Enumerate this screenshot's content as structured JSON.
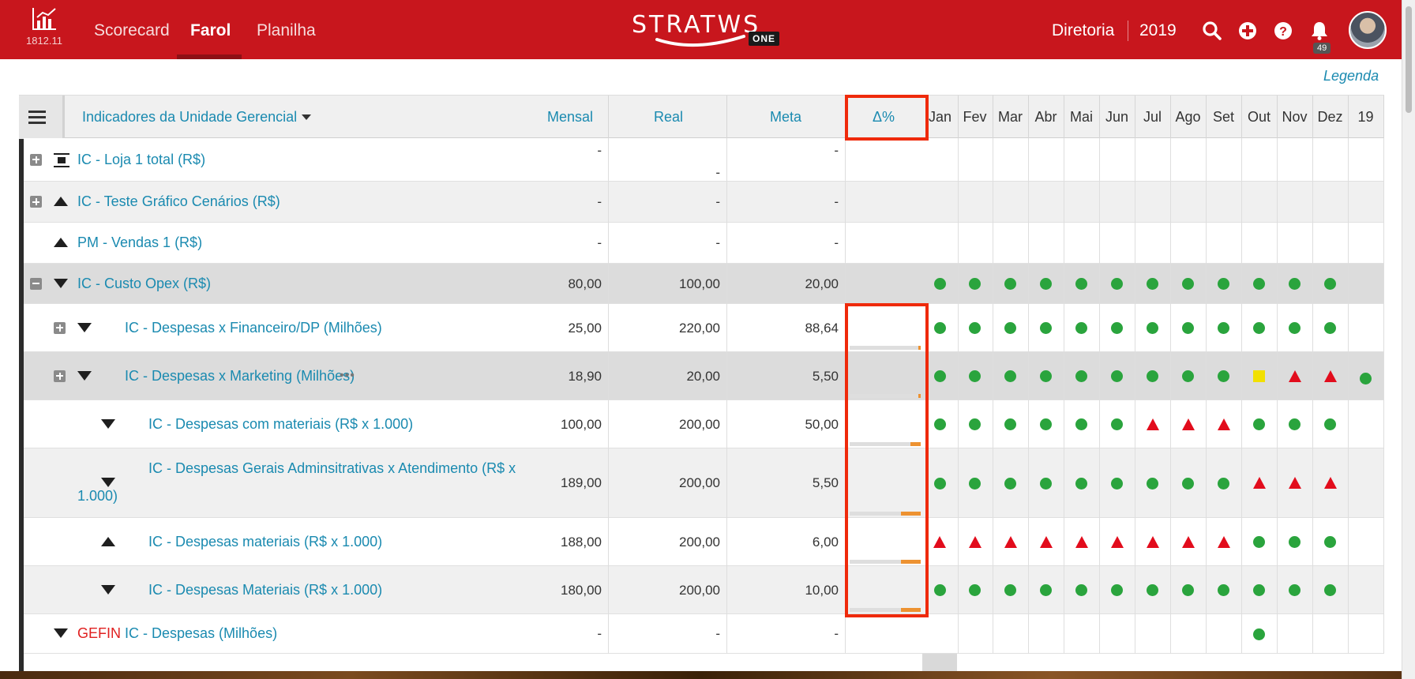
{
  "header": {
    "version": "1812.11",
    "tabs": [
      {
        "label": "Scorecard",
        "active": false
      },
      {
        "label": "Farol",
        "active": true
      },
      {
        "label": "Planilha",
        "active": false
      }
    ],
    "logo_text": "STRATWS",
    "logo_badge": "ONE",
    "unit": "Diretoria",
    "year": "2019",
    "notifications": "49",
    "icons": [
      "search-icon",
      "plus-circle-icon",
      "help-icon",
      "bell-icon"
    ]
  },
  "legend_link": "Legenda",
  "table": {
    "header": {
      "title": "Indicadores da Unidade Gerencial",
      "period": "Mensal",
      "real": "Real",
      "meta": "Meta",
      "delta": "Δ%",
      "months": [
        "Jan",
        "Fev",
        "Mar",
        "Abr",
        "Mai",
        "Jun",
        "Jul",
        "Ago",
        "Set",
        "Out",
        "Nov",
        "Dez",
        "19"
      ]
    },
    "rows": [
      {
        "name": "IC - Loja 1 total (R$)",
        "real": "-",
        "meta": "-",
        "delta": "-",
        "icon": "rectangle-lines-icon",
        "expand": "plus"
      },
      {
        "name": "IC - Teste Gráfico Cenários (R$)",
        "real": "-",
        "meta": "-",
        "delta": "-",
        "icon": "triangle-up-icon",
        "expand": "plus"
      },
      {
        "name": "PM - Vendas 1 (R$)",
        "real": "-",
        "meta": "-",
        "delta": "-",
        "icon": "triangle-up-icon",
        "expand": ""
      },
      {
        "name": "IC - Custo Opex (R$)",
        "real": "80,00",
        "meta": "100,00",
        "delta": "20,00",
        "icon": "triangle-down-icon",
        "expand": "minus"
      },
      {
        "name": "IC - Despesas x Financeiro/DP (Milhões)",
        "real": "25,00",
        "meta": "220,00",
        "delta": "88,64",
        "icon": "triangle-down-icon",
        "expand": "plus",
        "progress": 0.03
      },
      {
        "name": "IC - Despesas x Marketing (Milhões)",
        "real": "18,90",
        "meta": "20,00",
        "delta": "5,50",
        "icon": "triangle-down-icon",
        "expand": "plus",
        "more": "•••",
        "progress": 0.03
      },
      {
        "name": "IC - Despesas com materiais (R$ x 1.000)",
        "real": "100,00",
        "meta": "200,00",
        "delta": "50,00",
        "icon": "triangle-down-icon",
        "expand": "",
        "progress": 0.15
      },
      {
        "name_line1": "IC - Despesas Gerais Adminsitrativas x Atendimento (R$ x",
        "name_line2": "1.000)",
        "real": "189,00",
        "meta": "200,00",
        "delta": "5,50",
        "icon": "triangle-down-icon",
        "expand": "",
        "progress": 0.28
      },
      {
        "name": "IC - Despesas materiais (R$ x 1.000)",
        "real": "188,00",
        "meta": "200,00",
        "delta": "6,00",
        "icon": "triangle-up-icon",
        "expand": "",
        "progress": 0.28
      },
      {
        "name": "IC - Despesas Materiais (R$ x 1.000)",
        "real": "180,00",
        "meta": "200,00",
        "delta": "10,00",
        "icon": "triangle-down-icon",
        "expand": "",
        "progress": 0.28
      },
      {
        "prefix": "GEFIN",
        "name": "IC - Despesas (Milhões)",
        "real": "-",
        "meta": "-",
        "delta": "-",
        "icon": "triangle-down-icon",
        "expand": ""
      }
    ],
    "status": [
      [],
      [],
      [],
      [
        "green",
        "green",
        "green",
        "green",
        "green",
        "green",
        "green",
        "green",
        "green",
        "green",
        "green",
        "green"
      ],
      [
        "green",
        "green",
        "green",
        "green",
        "green",
        "green",
        "green",
        "green",
        "green",
        "green",
        "green",
        "green"
      ],
      [
        "green",
        "green",
        "green",
        "green",
        "green",
        "green",
        "green",
        "green",
        "green",
        "yellow",
        "red",
        "red",
        "green"
      ],
      [
        "green",
        "green",
        "green",
        "green",
        "green",
        "green",
        "red",
        "red",
        "red",
        "green",
        "green",
        "green"
      ],
      [
        "green",
        "green",
        "green",
        "green",
        "green",
        "green",
        "green",
        "green",
        "green",
        "red",
        "red",
        "red"
      ],
      [
        "red",
        "red",
        "red",
        "red",
        "red",
        "red",
        "red",
        "red",
        "red",
        "green",
        "green",
        "green"
      ],
      [
        "green",
        "green",
        "green",
        "green",
        "green",
        "green",
        "green",
        "green",
        "green",
        "green",
        "green",
        "green"
      ],
      [
        "",
        "",
        "",
        "",
        "",
        "",
        "",
        "",
        "",
        "green"
      ]
    ],
    "status_colors": {
      "green": "#2aa43d",
      "red": "#e20c1c",
      "yellow": "#f2e000"
    }
  }
}
